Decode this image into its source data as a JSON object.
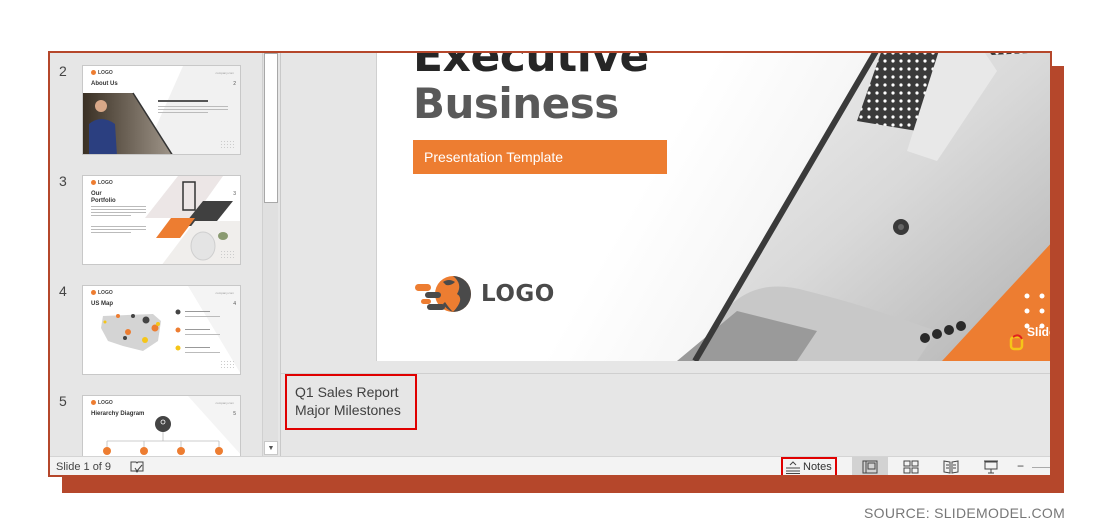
{
  "thumbnails": [
    {
      "number": "2",
      "title_a": "About",
      "title_b": "Us",
      "slide_num": "2",
      "logo": "LOGO",
      "tagline": "You can edit this tagline here"
    },
    {
      "number": "3",
      "title_a": "Our",
      "title_b": "Portfolio",
      "slide_num": "3",
      "logo": "LOGO"
    },
    {
      "number": "4",
      "title_a": "US",
      "title_b": "Map",
      "slide_num": "4",
      "logo": "LOGO"
    },
    {
      "number": "5",
      "title_a": "Hierarchy",
      "title_b": "Diagram",
      "slide_num": "5",
      "logo": "LOGO",
      "levels": [
        "01",
        "02",
        "03",
        "04"
      ]
    }
  ],
  "slide": {
    "title_line1": "Executive",
    "title_line2": "Business",
    "subtitle": "Presentation Template",
    "logo_text": "LOGO",
    "brand": "Slide",
    "accent_color": "#ed7d31"
  },
  "notes": {
    "lines": [
      "Q1 Sales Report",
      "Major Milestones"
    ]
  },
  "statusbar": {
    "slide_count": "Slide 1 of 9",
    "notes_label": "Notes",
    "views": [
      "normal-view",
      "slide-sorter-view",
      "reading-view",
      "slide-show-view"
    ],
    "active_view": "normal-view"
  },
  "source": "SOURCE: SLIDEMODEL.COM",
  "colors": {
    "frame": "#b5472b",
    "highlight": "#e00000",
    "accent": "#ed7d31"
  }
}
